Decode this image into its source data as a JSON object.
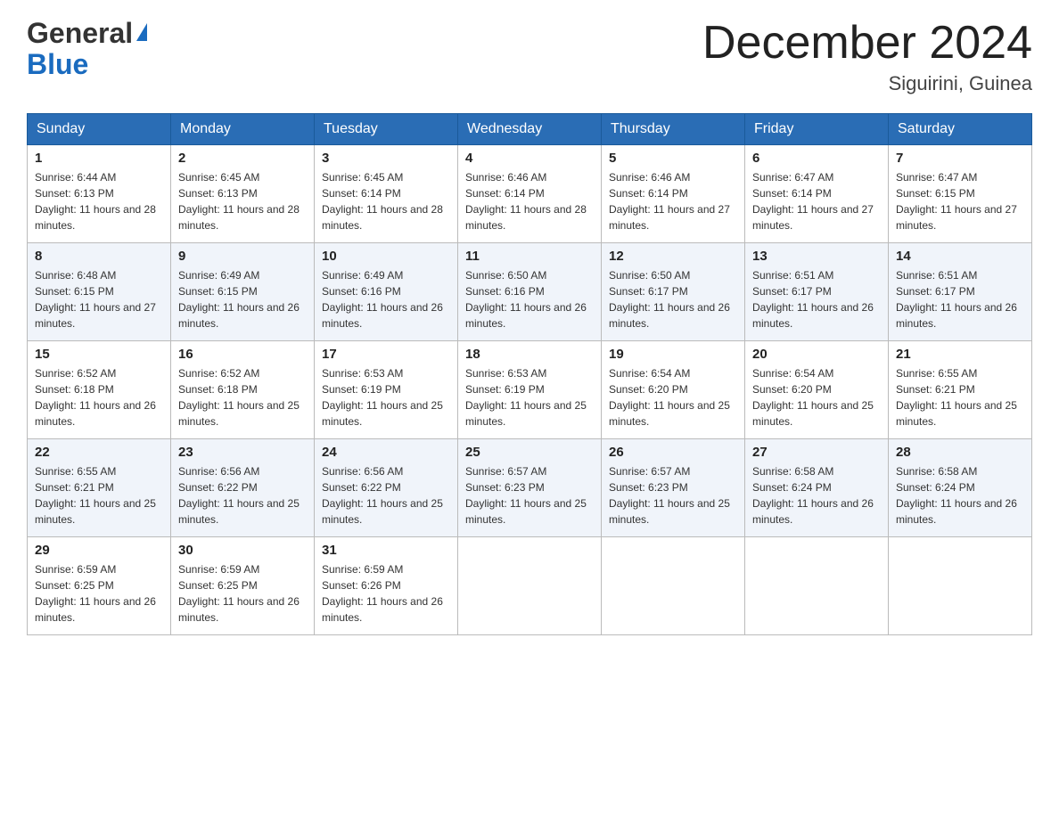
{
  "header": {
    "logo_general": "General",
    "logo_blue": "Blue",
    "month_title": "December 2024",
    "location": "Siguirini, Guinea"
  },
  "weekdays": [
    "Sunday",
    "Monday",
    "Tuesday",
    "Wednesday",
    "Thursday",
    "Friday",
    "Saturday"
  ],
  "weeks": [
    [
      {
        "day": "1",
        "sunrise": "6:44 AM",
        "sunset": "6:13 PM",
        "daylight": "11 hours and 28 minutes."
      },
      {
        "day": "2",
        "sunrise": "6:45 AM",
        "sunset": "6:13 PM",
        "daylight": "11 hours and 28 minutes."
      },
      {
        "day": "3",
        "sunrise": "6:45 AM",
        "sunset": "6:14 PM",
        "daylight": "11 hours and 28 minutes."
      },
      {
        "day": "4",
        "sunrise": "6:46 AM",
        "sunset": "6:14 PM",
        "daylight": "11 hours and 28 minutes."
      },
      {
        "day": "5",
        "sunrise": "6:46 AM",
        "sunset": "6:14 PM",
        "daylight": "11 hours and 27 minutes."
      },
      {
        "day": "6",
        "sunrise": "6:47 AM",
        "sunset": "6:14 PM",
        "daylight": "11 hours and 27 minutes."
      },
      {
        "day": "7",
        "sunrise": "6:47 AM",
        "sunset": "6:15 PM",
        "daylight": "11 hours and 27 minutes."
      }
    ],
    [
      {
        "day": "8",
        "sunrise": "6:48 AM",
        "sunset": "6:15 PM",
        "daylight": "11 hours and 27 minutes."
      },
      {
        "day": "9",
        "sunrise": "6:49 AM",
        "sunset": "6:15 PM",
        "daylight": "11 hours and 26 minutes."
      },
      {
        "day": "10",
        "sunrise": "6:49 AM",
        "sunset": "6:16 PM",
        "daylight": "11 hours and 26 minutes."
      },
      {
        "day": "11",
        "sunrise": "6:50 AM",
        "sunset": "6:16 PM",
        "daylight": "11 hours and 26 minutes."
      },
      {
        "day": "12",
        "sunrise": "6:50 AM",
        "sunset": "6:17 PM",
        "daylight": "11 hours and 26 minutes."
      },
      {
        "day": "13",
        "sunrise": "6:51 AM",
        "sunset": "6:17 PM",
        "daylight": "11 hours and 26 minutes."
      },
      {
        "day": "14",
        "sunrise": "6:51 AM",
        "sunset": "6:17 PM",
        "daylight": "11 hours and 26 minutes."
      }
    ],
    [
      {
        "day": "15",
        "sunrise": "6:52 AM",
        "sunset": "6:18 PM",
        "daylight": "11 hours and 26 minutes."
      },
      {
        "day": "16",
        "sunrise": "6:52 AM",
        "sunset": "6:18 PM",
        "daylight": "11 hours and 25 minutes."
      },
      {
        "day": "17",
        "sunrise": "6:53 AM",
        "sunset": "6:19 PM",
        "daylight": "11 hours and 25 minutes."
      },
      {
        "day": "18",
        "sunrise": "6:53 AM",
        "sunset": "6:19 PM",
        "daylight": "11 hours and 25 minutes."
      },
      {
        "day": "19",
        "sunrise": "6:54 AM",
        "sunset": "6:20 PM",
        "daylight": "11 hours and 25 minutes."
      },
      {
        "day": "20",
        "sunrise": "6:54 AM",
        "sunset": "6:20 PM",
        "daylight": "11 hours and 25 minutes."
      },
      {
        "day": "21",
        "sunrise": "6:55 AM",
        "sunset": "6:21 PM",
        "daylight": "11 hours and 25 minutes."
      }
    ],
    [
      {
        "day": "22",
        "sunrise": "6:55 AM",
        "sunset": "6:21 PM",
        "daylight": "11 hours and 25 minutes."
      },
      {
        "day": "23",
        "sunrise": "6:56 AM",
        "sunset": "6:22 PM",
        "daylight": "11 hours and 25 minutes."
      },
      {
        "day": "24",
        "sunrise": "6:56 AM",
        "sunset": "6:22 PM",
        "daylight": "11 hours and 25 minutes."
      },
      {
        "day": "25",
        "sunrise": "6:57 AM",
        "sunset": "6:23 PM",
        "daylight": "11 hours and 25 minutes."
      },
      {
        "day": "26",
        "sunrise": "6:57 AM",
        "sunset": "6:23 PM",
        "daylight": "11 hours and 25 minutes."
      },
      {
        "day": "27",
        "sunrise": "6:58 AM",
        "sunset": "6:24 PM",
        "daylight": "11 hours and 26 minutes."
      },
      {
        "day": "28",
        "sunrise": "6:58 AM",
        "sunset": "6:24 PM",
        "daylight": "11 hours and 26 minutes."
      }
    ],
    [
      {
        "day": "29",
        "sunrise": "6:59 AM",
        "sunset": "6:25 PM",
        "daylight": "11 hours and 26 minutes."
      },
      {
        "day": "30",
        "sunrise": "6:59 AM",
        "sunset": "6:25 PM",
        "daylight": "11 hours and 26 minutes."
      },
      {
        "day": "31",
        "sunrise": "6:59 AM",
        "sunset": "6:26 PM",
        "daylight": "11 hours and 26 minutes."
      },
      null,
      null,
      null,
      null
    ]
  ]
}
